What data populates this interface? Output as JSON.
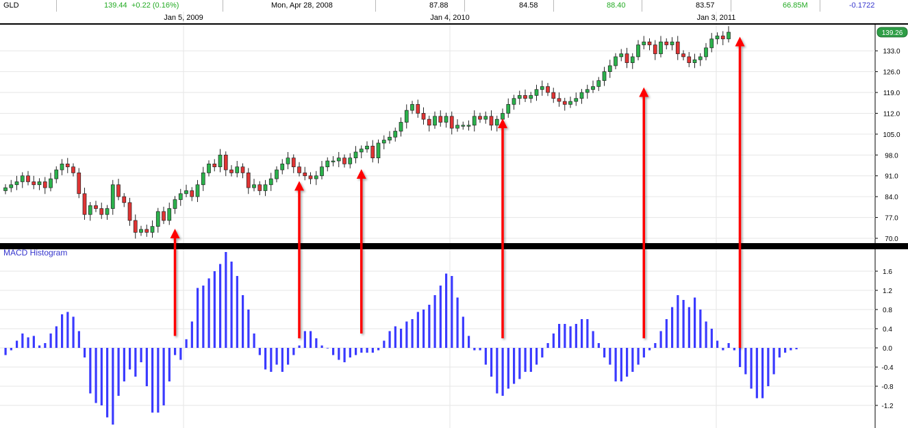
{
  "header": {
    "symbol": "GLD",
    "last": "139.44",
    "change": "+0.22 (0.16%)",
    "date": "Mon, Apr 28, 2008",
    "open": "87.88",
    "low": "84.58",
    "high": "88.40",
    "close": "83.57",
    "volume": "66.85M",
    "indicator": "-0.1722"
  },
  "colors": {
    "up": "#2bb24c",
    "down": "#e03434",
    "histogram": "#3a3aff",
    "arrow": "#ff0000",
    "grid": "#e6e6e6",
    "green_text": "#22aa22",
    "blue_text": "#3333cc"
  },
  "chart_data": [
    {
      "type": "candlestick",
      "x_date_labels": [
        "Jan 5, 2009",
        "Jan 4, 2010",
        "Jan 3, 2011"
      ],
      "ylim": [
        70,
        139.26
      ],
      "y_ticks": [
        "133.0",
        "126.0",
        "119.0",
        "112.0",
        "105.0",
        "98.0",
        "91.0",
        "84.0",
        "77.0",
        "70.0"
      ],
      "last_price_label": "139.26",
      "close_series_weekly": [
        87,
        88,
        89,
        91,
        89,
        88,
        89,
        87,
        90,
        93,
        95,
        94,
        92,
        85,
        78,
        81,
        80,
        78,
        80,
        88,
        84,
        82,
        76,
        72,
        73,
        72,
        74,
        79,
        76,
        80,
        83,
        85,
        86,
        84,
        88,
        92,
        95,
        94,
        98,
        93,
        92,
        94,
        92,
        87,
        88,
        86,
        88,
        90,
        93,
        95,
        97,
        94,
        92,
        91,
        90,
        91,
        94,
        96,
        96,
        97,
        95,
        97,
        99,
        100,
        101,
        97,
        102,
        103,
        104,
        106,
        109,
        113,
        115,
        112,
        110,
        108,
        111,
        109,
        111,
        107,
        108,
        108,
        108,
        111,
        110,
        111,
        108,
        110,
        112,
        115,
        117,
        118,
        117,
        118,
        120,
        121,
        119,
        117,
        116,
        115,
        116,
        117,
        119,
        120,
        121,
        123,
        126,
        128,
        131,
        132,
        129,
        131,
        135,
        136,
        135,
        132,
        136,
        135,
        136,
        132,
        131,
        129,
        130,
        131,
        134,
        137,
        138,
        137,
        139.26
      ]
    },
    {
      "type": "bar",
      "title": "MACD Histogram",
      "ylim": [
        -1.6,
        2.0
      ],
      "y_ticks": [
        "1.6",
        "1.2",
        "0.8",
        "0.4",
        "0.0",
        "-0.4",
        "-0.8",
        "-1.2"
      ],
      "values_weekly": [
        -0.15,
        -0.05,
        0.15,
        0.3,
        0.22,
        0.25,
        0.05,
        0.1,
        0.3,
        0.45,
        0.7,
        0.75,
        0.65,
        0.35,
        -0.2,
        -0.95,
        -1.15,
        -1.2,
        -1.45,
        -1.6,
        -1.0,
        -0.7,
        -0.45,
        -0.6,
        -0.3,
        -0.8,
        -1.35,
        -1.35,
        -1.2,
        -0.7,
        -0.15,
        -0.25,
        0.18,
        0.55,
        1.25,
        1.3,
        1.45,
        1.6,
        1.75,
        2.0,
        1.8,
        1.5,
        1.1,
        0.8,
        0.3,
        -0.15,
        -0.45,
        -0.5,
        -0.35,
        -0.5,
        -0.35,
        -0.15,
        0.05,
        0.35,
        0.35,
        0.2,
        0.05,
        0.0,
        -0.15,
        -0.25,
        -0.3,
        -0.2,
        -0.15,
        -0.1,
        -0.1,
        -0.1,
        -0.05,
        0.15,
        0.35,
        0.45,
        0.4,
        0.55,
        0.6,
        0.75,
        0.8,
        0.9,
        1.1,
        1.3,
        1.55,
        1.5,
        1.05,
        0.65,
        0.25,
        -0.05,
        -0.05,
        -0.35,
        -0.6,
        -0.95,
        -1.0,
        -0.85,
        -0.75,
        -0.65,
        -0.5,
        -0.5,
        -0.35,
        -0.2,
        0.1,
        0.3,
        0.5,
        0.5,
        0.45,
        0.5,
        0.6,
        0.6,
        0.35,
        0.1,
        -0.2,
        -0.35,
        -0.7,
        -0.7,
        -0.6,
        -0.5,
        -0.35,
        -0.2,
        -0.05,
        0.1,
        0.35,
        0.6,
        0.85,
        1.1,
        1.0,
        0.85,
        1.05,
        0.8,
        0.55,
        0.4,
        0.15,
        -0.05,
        0.1,
        -0.05,
        -0.4,
        -0.55,
        -0.85,
        -1.05,
        -1.05,
        -0.8,
        -0.55,
        -0.2,
        -0.1,
        -0.05,
        -0.03
      ]
    }
  ],
  "arrows": [
    {
      "week": 30,
      "macd": 0.25,
      "price": 73.0
    },
    {
      "week": 52,
      "macd": 0.2,
      "price": 89.0
    },
    {
      "week": 63,
      "macd": 0.3,
      "price": 93.0
    },
    {
      "week": 88,
      "macd": 0.2,
      "price": 110.0
    },
    {
      "week": 113,
      "macd": 0.2,
      "price": 120.5
    },
    {
      "week": 130,
      "macd": 0.0,
      "price": 137.5
    }
  ]
}
